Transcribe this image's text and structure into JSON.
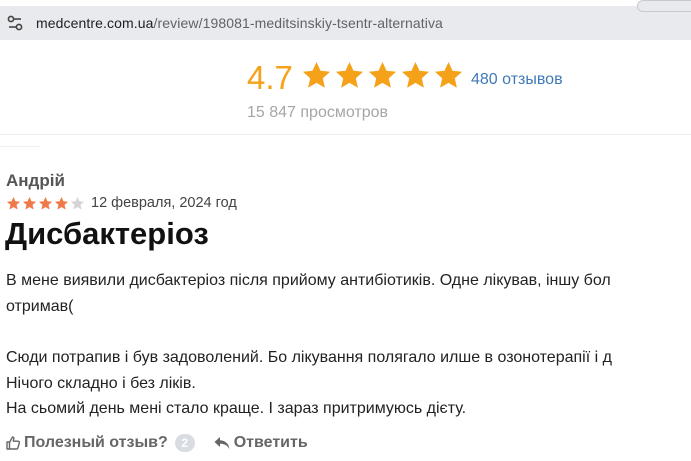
{
  "browser": {
    "url_host": "medcentre.com.ua",
    "url_path": "/review/198081-meditsinskiy-tsentr-alternativa"
  },
  "summary": {
    "rating": "4.7",
    "stars_filled": 5,
    "star_color": "#f5a11a",
    "reviews_link": "480 отзывов",
    "views": "15 847 просмотров"
  },
  "review": {
    "author": "Андрій",
    "rating_stars": 4,
    "star_color": "#ef7a4a",
    "date": "12 февраля, 2024 год",
    "title": "Дисбактеріоз",
    "paragraphs": [
      [
        "В мене виявили дисбактеріоз після прийому антибіотиків. Одне лікував, іншу бол",
        "отримав("
      ],
      [
        "Сюди потрапив і був задоволений. Бо лікування полягало илше в озонотерапії і д",
        "Нічого складно і без ліків.",
        "На сьомий день мені стало краще. І зараз притримуюсь дієту."
      ]
    ],
    "helpful_label": "Полезный отзыв?",
    "helpful_count": "2",
    "reply_label": "Ответить"
  }
}
